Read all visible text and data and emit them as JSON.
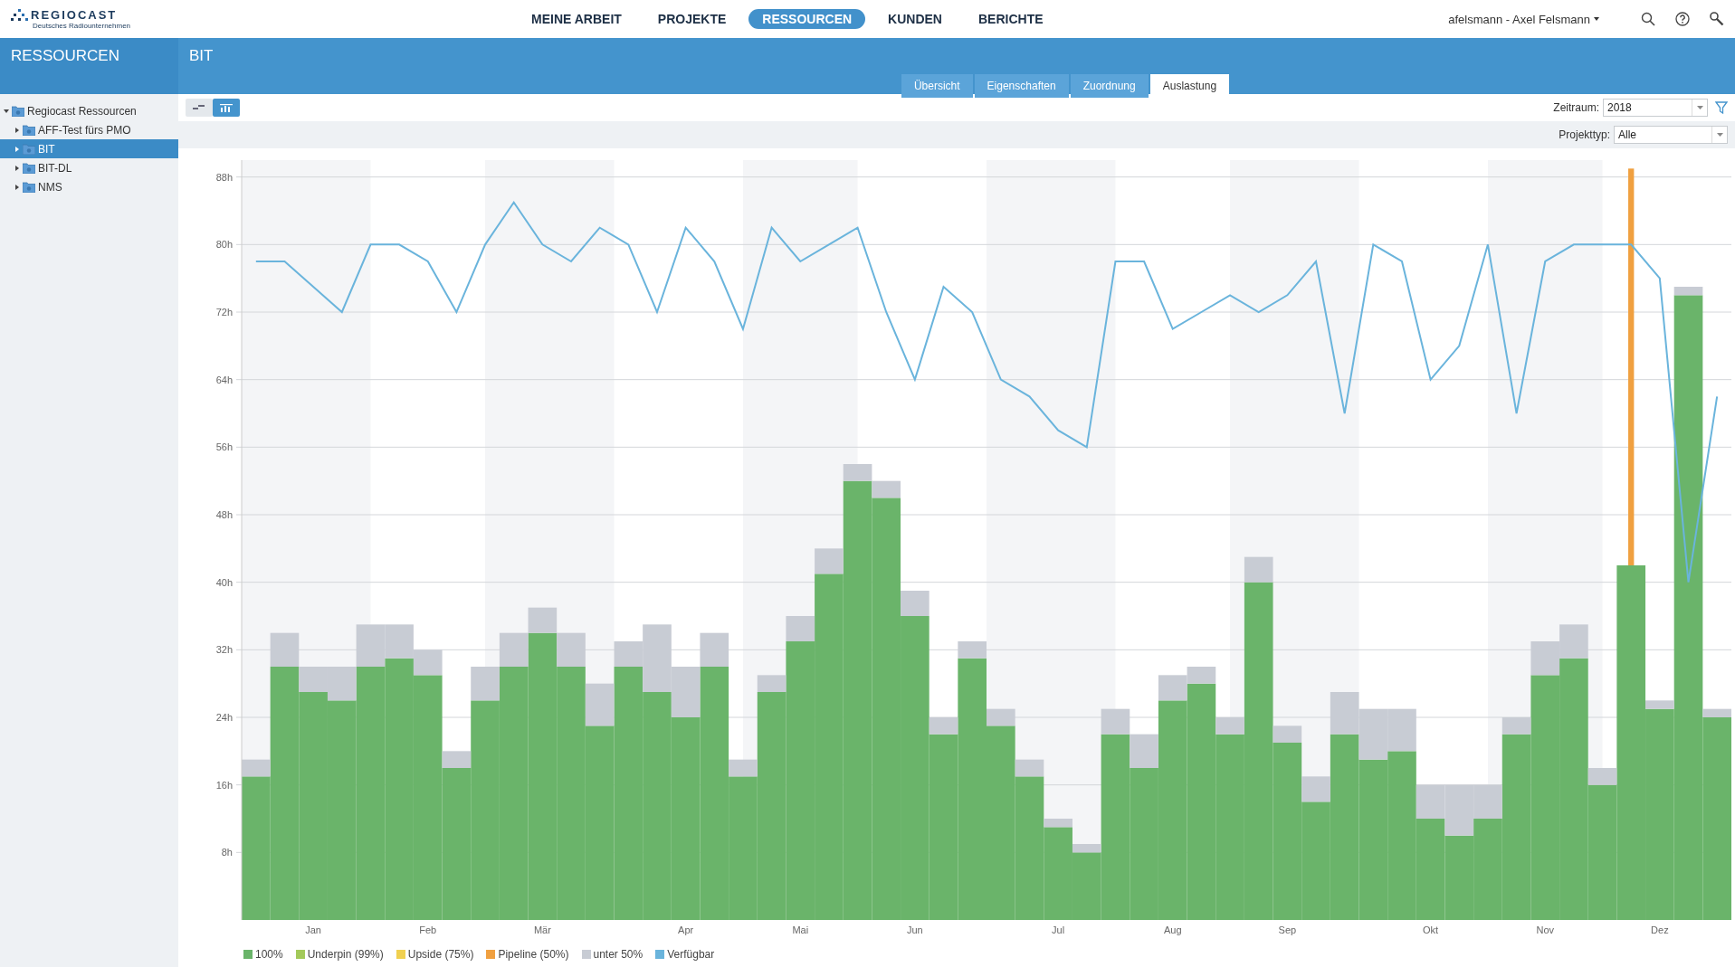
{
  "logo": {
    "name": "REGIOCAST",
    "tagline": "Deutsches Radiounternehmen"
  },
  "nav": [
    {
      "label": "MEINE ARBEIT",
      "selected": false
    },
    {
      "label": "PROJEKTE",
      "selected": false
    },
    {
      "label": "RESSOURCEN",
      "selected": true
    },
    {
      "label": "KUNDEN",
      "selected": false
    },
    {
      "label": "BERICHTE",
      "selected": false
    }
  ],
  "user": "afelsmann - Axel Felsmann",
  "section_title": "RESSOURCEN",
  "page_title": "BIT",
  "tabs": [
    {
      "label": "Übersicht",
      "selected": false
    },
    {
      "label": "Eigenschaften",
      "selected": false
    },
    {
      "label": "Zuordnung",
      "selected": false
    },
    {
      "label": "Auslastung",
      "selected": true
    }
  ],
  "sidebar": {
    "items": [
      {
        "label": "Regiocast Ressourcen",
        "expanded": true,
        "selected": false,
        "children": [
          {
            "label": "AFF-Test fürs PMO",
            "expanded": false,
            "selected": false
          },
          {
            "label": "BIT",
            "expanded": false,
            "selected": true
          },
          {
            "label": "BIT-DL",
            "expanded": false,
            "selected": false
          },
          {
            "label": "NMS",
            "expanded": false,
            "selected": false
          }
        ]
      }
    ]
  },
  "view_toggle": [
    {
      "kind": "gantt",
      "selected": false
    },
    {
      "kind": "chart",
      "selected": true
    }
  ],
  "filters": [
    {
      "label": "Zeitraum:",
      "value": "2018"
    },
    {
      "label": "Projekttyp:",
      "value": "Alle"
    }
  ],
  "chart_data": {
    "type": "bar",
    "stacked": true,
    "grid": true,
    "ylim": [
      0,
      90
    ],
    "yticks": [
      {
        "value": 8,
        "label": "8h"
      },
      {
        "value": 16,
        "label": "16h"
      },
      {
        "value": 24,
        "label": "24h"
      },
      {
        "value": 32,
        "label": "32h"
      },
      {
        "value": 40,
        "label": "40h"
      },
      {
        "value": 48,
        "label": "48h"
      },
      {
        "value": 56,
        "label": "56h"
      },
      {
        "value": 64,
        "label": "64h"
      },
      {
        "value": 72,
        "label": "72h"
      },
      {
        "value": 80,
        "label": "80h"
      },
      {
        "value": 88,
        "label": "88h"
      }
    ],
    "categories": [
      null,
      null,
      "Jan",
      null,
      null,
      null,
      "Feb",
      null,
      null,
      null,
      "Mär",
      null,
      null,
      null,
      null,
      "Apr",
      null,
      null,
      null,
      "Mai",
      null,
      null,
      null,
      "Jun",
      null,
      null,
      null,
      null,
      "Jul",
      null,
      null,
      null,
      "Aug",
      null,
      null,
      null,
      "Sep",
      null,
      null,
      null,
      null,
      "Okt",
      null,
      null,
      null,
      "Nov",
      null,
      null,
      null,
      "Dez",
      null,
      null
    ],
    "series": [
      {
        "name": "100%",
        "type": "bar",
        "color": "#6ab46a",
        "values": [
          17,
          30,
          27,
          26,
          30,
          31,
          29,
          18,
          26,
          30,
          34,
          30,
          23,
          30,
          27,
          24,
          30,
          17,
          27,
          33,
          41,
          52,
          50,
          36,
          22,
          31,
          23,
          17,
          11,
          8,
          22,
          18,
          26,
          28,
          22,
          40,
          21,
          14,
          22,
          19,
          20,
          12,
          10,
          12,
          22,
          29,
          31,
          16,
          42,
          25,
          74,
          24
        ]
      },
      {
        "name": "Underpin (99%)",
        "type": "bar",
        "color": "#a3c95a",
        "values": [
          0,
          0,
          0,
          0,
          0,
          0,
          0,
          0,
          0,
          0,
          0,
          0,
          0,
          0,
          0,
          0,
          0,
          0,
          0,
          0,
          0,
          0,
          0,
          0,
          0,
          0,
          0,
          0,
          0,
          0,
          0,
          0,
          0,
          0,
          0,
          0,
          0,
          0,
          0,
          0,
          0,
          0,
          0,
          0,
          0,
          0,
          0,
          0,
          0,
          0,
          0,
          0
        ]
      },
      {
        "name": "Upside (75%)",
        "type": "bar",
        "color": "#f0d050",
        "values": [
          0,
          0,
          0,
          0,
          0,
          0,
          0,
          0,
          0,
          0,
          0,
          0,
          0,
          0,
          0,
          0,
          0,
          0,
          0,
          0,
          0,
          0,
          0,
          0,
          0,
          0,
          0,
          0,
          0,
          0,
          0,
          0,
          0,
          0,
          0,
          0,
          0,
          0,
          0,
          0,
          0,
          0,
          0,
          0,
          0,
          0,
          0,
          0,
          0,
          0,
          0,
          0
        ]
      },
      {
        "name": "Pipeline (50%)",
        "type": "bar",
        "color": "#f0a040",
        "values": [
          0,
          0,
          0,
          0,
          0,
          0,
          0,
          0,
          0,
          0,
          0,
          0,
          0,
          0,
          0,
          0,
          0,
          0,
          0,
          0,
          0,
          0,
          0,
          0,
          0,
          0,
          0,
          0,
          0,
          0,
          0,
          0,
          0,
          0,
          0,
          0,
          0,
          0,
          0,
          0,
          0,
          0,
          0,
          0,
          0,
          0,
          0,
          0,
          47,
          0,
          0,
          0
        ]
      },
      {
        "name": "unter 50%",
        "type": "bar",
        "color": "#c8ccd4",
        "values": [
          2,
          4,
          3,
          4,
          5,
          4,
          3,
          2,
          4,
          4,
          3,
          4,
          5,
          3,
          8,
          6,
          4,
          2,
          2,
          3,
          3,
          2,
          2,
          3,
          2,
          2,
          2,
          2,
          1,
          1,
          3,
          4,
          3,
          2,
          2,
          3,
          2,
          3,
          5,
          6,
          5,
          4,
          6,
          4,
          2,
          4,
          4,
          2,
          0,
          1,
          1,
          1
        ]
      },
      {
        "name": "Verfügbar",
        "type": "line",
        "color": "#6ab4dc",
        "values": [
          78,
          78,
          75,
          72,
          80,
          80,
          78,
          72,
          80,
          85,
          80,
          78,
          82,
          80,
          72,
          82,
          78,
          70,
          82,
          78,
          80,
          82,
          72,
          64,
          75,
          72,
          64,
          62,
          58,
          56,
          78,
          78,
          70,
          72,
          74,
          72,
          74,
          78,
          60,
          80,
          78,
          64,
          68,
          80,
          60,
          78,
          80,
          80,
          80,
          76,
          40,
          62
        ]
      }
    ]
  }
}
